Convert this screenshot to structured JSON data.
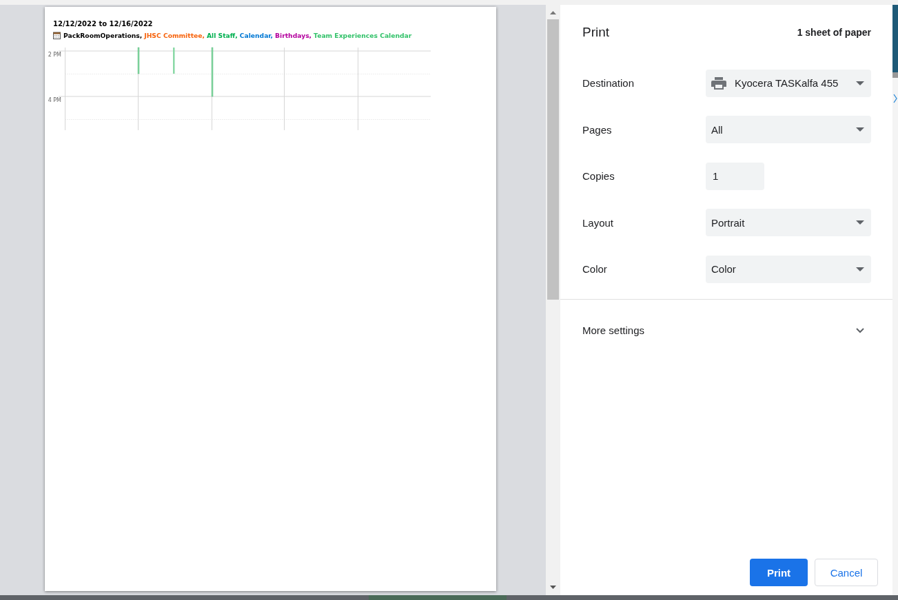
{
  "preview": {
    "date_range": "12/12/2022 to 12/16/2022",
    "calendars": [
      {
        "name": "PackRoomOperations,",
        "color": "#000000"
      },
      {
        "name": "JHSC Committee,",
        "color": "#f7630c"
      },
      {
        "name": "All Staff,",
        "color": "#00b050"
      },
      {
        "name": "Calendar,",
        "color": "#0078d4"
      },
      {
        "name": "Birthdays,",
        "color": "#b4009e"
      },
      {
        "name": "Team Experiences Calendar",
        "color": "#33c26a"
      }
    ],
    "time_labels": [
      "2 PM",
      "4 PM"
    ]
  },
  "print_panel": {
    "title": "Print",
    "summary": "1 sheet of paper",
    "settings": [
      {
        "label": "Destination",
        "kind": "select",
        "value": "Kyocera TASKalfa 455",
        "printer_icon": true
      },
      {
        "label": "Pages",
        "kind": "select",
        "value": "All"
      },
      {
        "label": "Copies",
        "kind": "input",
        "value": "1"
      },
      {
        "label": "Layout",
        "kind": "select",
        "value": "Portrait"
      },
      {
        "label": "Color",
        "kind": "select",
        "value": "Color"
      }
    ],
    "more_settings": {
      "label": "More settings",
      "expanded": false
    },
    "buttons": [
      {
        "label": "Print",
        "kind": "primary"
      },
      {
        "label": "Cancel",
        "kind": "secondary"
      }
    ]
  }
}
